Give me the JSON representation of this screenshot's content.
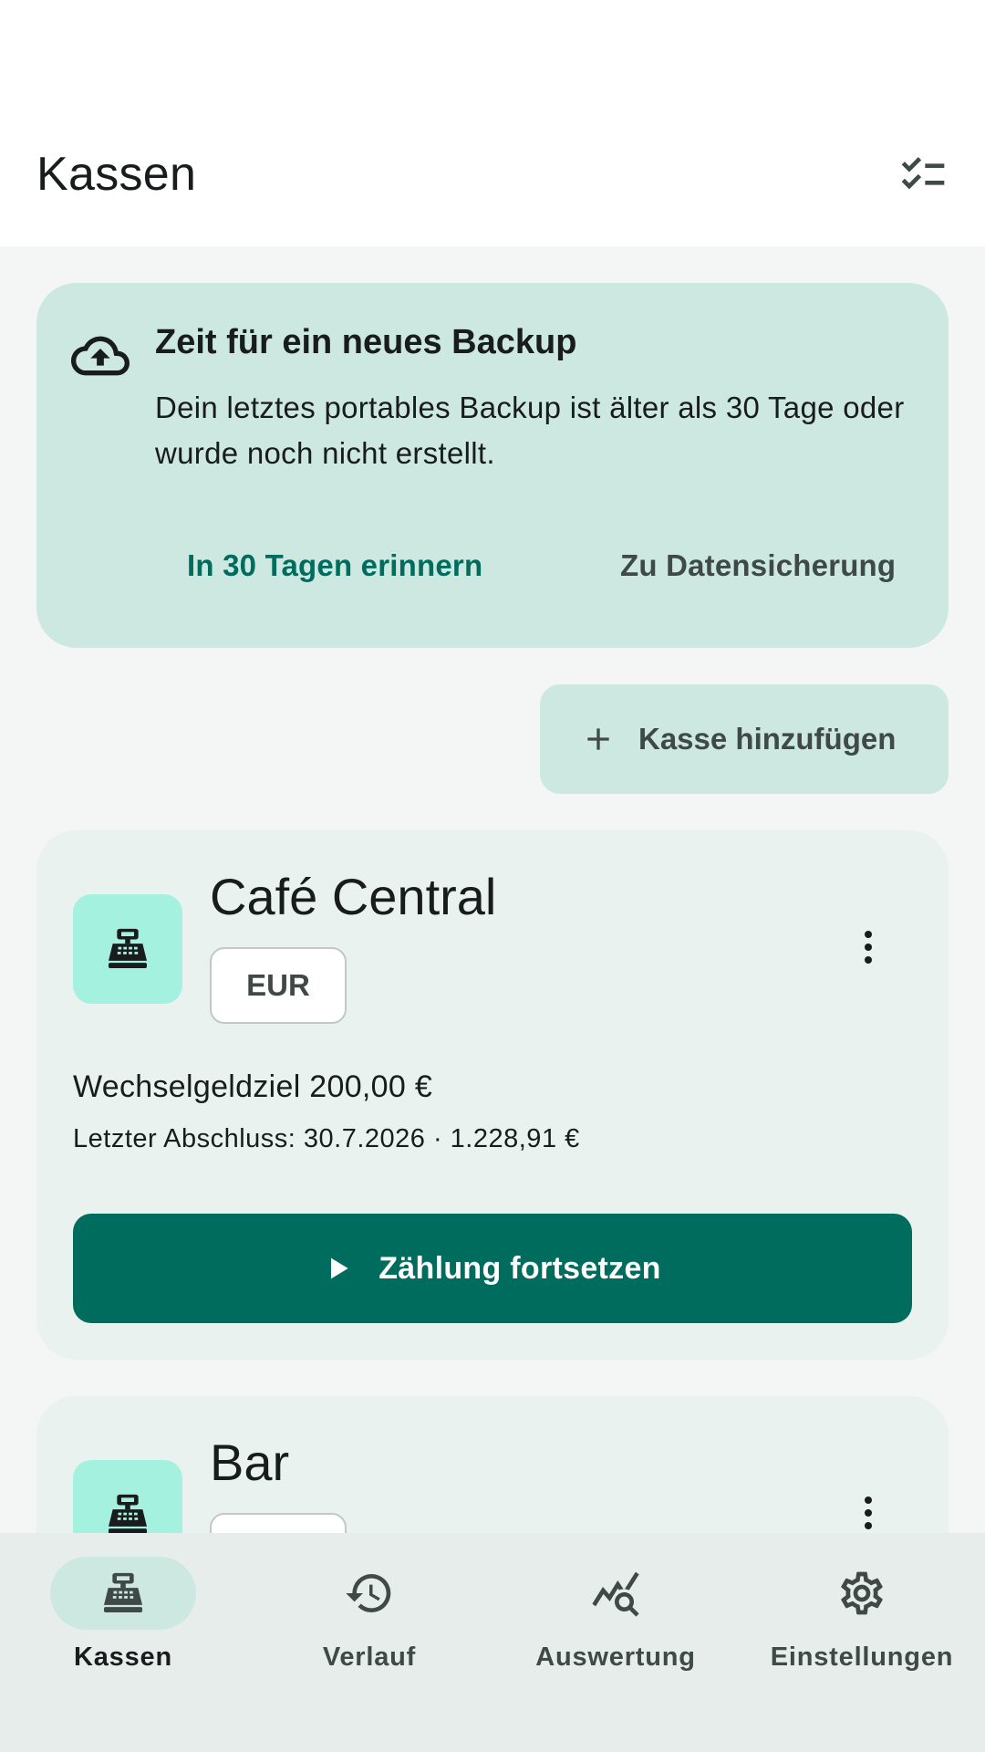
{
  "app_bar": {
    "title": "Kassen",
    "action_icon": "checklist-icon"
  },
  "backup_banner": {
    "icon": "cloud-upload-icon",
    "title": "Zeit für ein neues Backup",
    "text": "Dein letztes portables Backup ist älter als 30 Tage oder wurde noch nicht erstellt.",
    "remind_label": "In 30 Tagen erinnern",
    "goto_label": "Zu Datensicherung"
  },
  "add_register": {
    "icon": "plus-icon",
    "label": "Kasse hinzufügen"
  },
  "registers": [
    {
      "icon": "cash-register-icon",
      "name": "Café Central",
      "currency": "EUR",
      "change_target": "Wechselgeldziel 200,00 €",
      "last_closing": "Letzter Abschluss: 30.7.2026 · 1.228,91 €",
      "action_label": "Zählung fortsetzen"
    },
    {
      "icon": "cash-register-icon",
      "name": "Bar"
    }
  ],
  "bottom_nav": {
    "items": [
      {
        "label": "Kassen",
        "icon": "cash-register-icon",
        "active": true
      },
      {
        "label": "Verlauf",
        "icon": "history-icon",
        "active": false
      },
      {
        "label": "Auswertung",
        "icon": "analytics-icon",
        "active": false
      },
      {
        "label": "Einstellungen",
        "icon": "gear-icon",
        "active": false
      }
    ]
  },
  "colors": {
    "primary": "#006c5e",
    "container": "#cde8e1",
    "register_tile": "#a4f1e0",
    "card": "#eaf2ef",
    "nav_bg": "#e6edeb"
  }
}
